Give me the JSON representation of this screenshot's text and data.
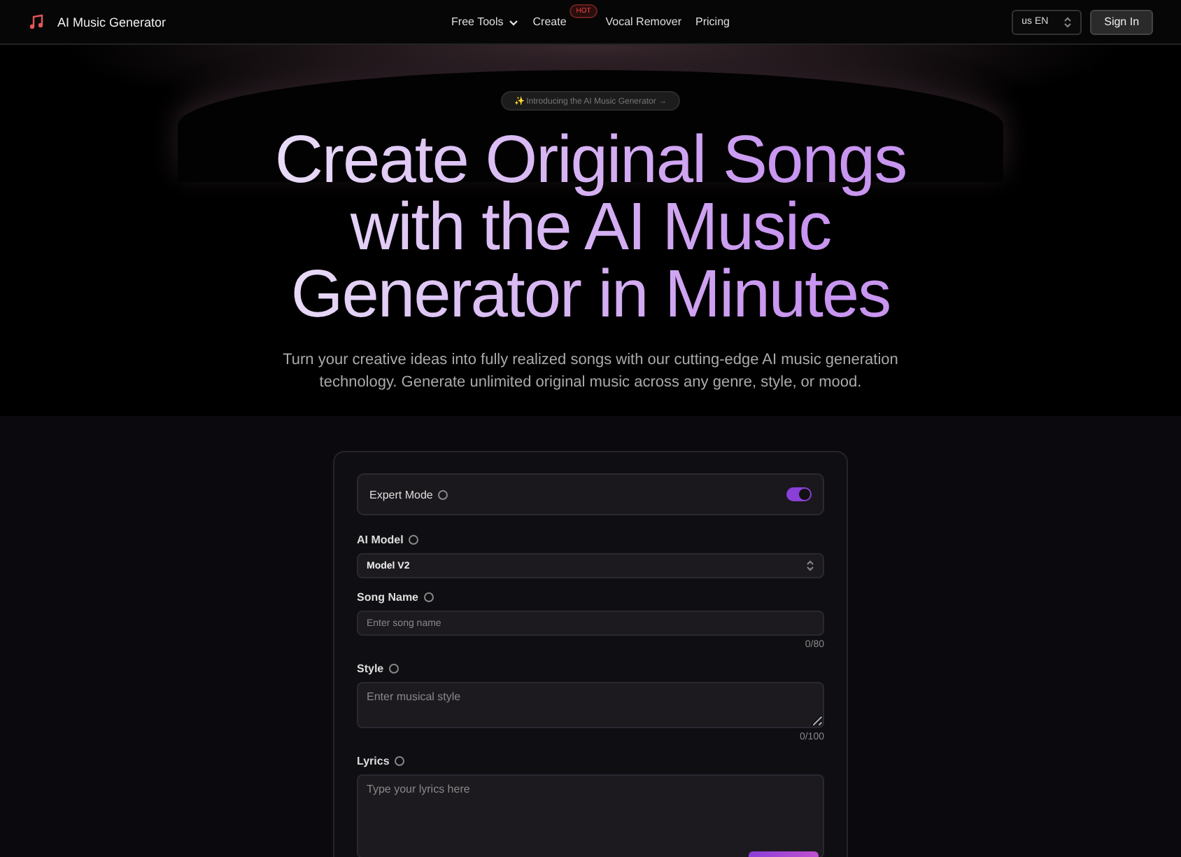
{
  "header": {
    "brand": "AI Music Generator",
    "nav": [
      {
        "label": "Free Tools",
        "kind": "dropdown"
      },
      {
        "label": "Create",
        "kind": "link",
        "badge": "HOT"
      },
      {
        "label": "Vocal Remover",
        "kind": "link"
      },
      {
        "label": "Pricing",
        "kind": "link"
      }
    ],
    "language": "us EN",
    "sign_in": "Sign In"
  },
  "hero": {
    "announcement": "✨ Introducing the AI Music Generator →",
    "title": "Create Original Songs with the AI Music Generator in Minutes",
    "subtitle": "Turn your creative ideas into fully realized songs with our cutting-edge AI music generation technology. Generate unlimited original music across any genre, style, or mood."
  },
  "form": {
    "expert_mode": {
      "label": "Expert Mode",
      "on": true
    },
    "fields": [
      {
        "kind": "select",
        "label": "AI Model",
        "value": "Model V2"
      },
      {
        "kind": "input",
        "label": "Song Name",
        "placeholder": "Enter song name",
        "count": "0/80"
      },
      {
        "kind": "textarea",
        "label": "Style",
        "placeholder": "Enter musical style",
        "count": "0/100"
      },
      {
        "kind": "lyrics",
        "label": "Lyrics",
        "placeholder": "Type your lyrics here"
      }
    ]
  }
}
